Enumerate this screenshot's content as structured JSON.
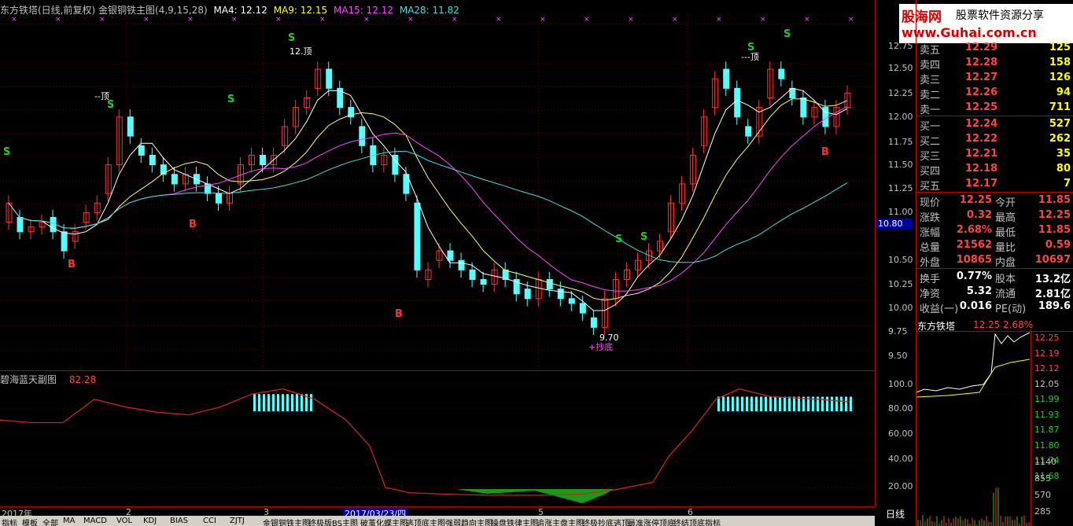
{
  "header": {
    "title": "东方铁塔(日线,前复权)",
    "indicator": "金银铜铁主图(4,9,15,28)",
    "ma": [
      {
        "label": "MA4: 12.12",
        "color": "#ffffff"
      },
      {
        "label": "MA9: 12.15",
        "color": "#ffff00"
      },
      {
        "label": "MA15: 12.12",
        "color": "#ff44ff"
      },
      {
        "label": "MA28: 11.82",
        "color": "#44dddd"
      }
    ]
  },
  "logo": {
    "line1": "股海网",
    "line2": "股票软件资源分享",
    "line3": "www.Guhai.com.cn"
  },
  "price_axis": [
    "12.75",
    "12.50",
    "12.25",
    "12.00",
    "11.75",
    "11.50",
    "11.25",
    "11.00",
    "10.80",
    "10.50",
    "10.25",
    "10.00",
    "9.75",
    "9.50"
  ],
  "price_axis_badge": "10.80",
  "annotations": {
    "top_left_peak": "--顶",
    "top_mid_peak": "12.顶",
    "top_right_peak": "---顶",
    "low_label": "9.70",
    "low_bottom": "+抄底",
    "buy": "B",
    "sell": "S"
  },
  "sub_panel": {
    "title": "碧海蓝天副图",
    "value": "82.28",
    "axis": [
      "100.0",
      "80.00",
      "60.00",
      "40.00",
      "20.00"
    ]
  },
  "bottom_axis": {
    "labels": [
      "2017年",
      "2",
      "3",
      "2017/03/23/四",
      "5",
      "6"
    ],
    "right": "日线"
  },
  "tabs": [
    "指标",
    "模板",
    "全部",
    "MA",
    "MACD",
    "VOL",
    "KDJ",
    "BIAS",
    "CCI",
    "ZJTJ",
    "金银铜铁主图",
    "终极版BS主图",
    "破茧化蝶主图",
    "逃顶底主图",
    "强弱趋向主图",
    "操盘铁律主图",
    "追涨主盘主图",
    "终极抄底逃顶",
    "最准涨停顶底",
    "终结顶底指标"
  ],
  "quote": {
    "asks": [
      {
        "label": "卖五",
        "price": "12.29",
        "vol": "125"
      },
      {
        "label": "卖四",
        "price": "12.28",
        "vol": "158"
      },
      {
        "label": "卖三",
        "price": "12.27",
        "vol": "126"
      },
      {
        "label": "卖二",
        "price": "12.26",
        "vol": "94"
      },
      {
        "label": "卖一",
        "price": "12.25",
        "vol": "711"
      }
    ],
    "bids": [
      {
        "label": "买一",
        "price": "12.24",
        "vol": "527"
      },
      {
        "label": "买二",
        "price": "12.22",
        "vol": "262"
      },
      {
        "label": "买三",
        "price": "12.21",
        "vol": "35"
      },
      {
        "label": "买四",
        "price": "12.18",
        "vol": "80"
      },
      {
        "label": "买五",
        "price": "12.17",
        "vol": "7"
      }
    ],
    "stats": [
      {
        "l1": "现价",
        "v1": "12.25",
        "l2": "今开",
        "v2": "11.85"
      },
      {
        "l1": "涨跌",
        "v1": "0.32",
        "l2": "最高",
        "v2": "12.25"
      },
      {
        "l1": "涨幅",
        "v1": "2.68%",
        "l2": "最低",
        "v2": "11.85"
      },
      {
        "l1": "总量",
        "v1": "21562",
        "l2": "量比",
        "v2": "0.59"
      },
      {
        "l1": "外盘",
        "v1": "10865",
        "l2": "内盘",
        "v2": "10697"
      }
    ],
    "stats2": [
      {
        "l1": "换手",
        "v1": "0.77%",
        "l2": "股本",
        "v2": "13.2亿"
      },
      {
        "l1": "净资",
        "v1": "5.32",
        "l2": "流通",
        "v2": "2.81亿"
      },
      {
        "l1": "收益(一)",
        "v1": "0.016",
        "l2": "PE(动)",
        "v2": "189.6"
      }
    ]
  },
  "mini": {
    "name": "东方铁塔",
    "price": "12.25",
    "pct": "2.68%",
    "axis": [
      "12.25",
      "12.19",
      "12.12",
      "12.05",
      "11.99",
      "11.93",
      "11.87",
      "11.80",
      "11.74",
      "11.68"
    ],
    "vol_axis": [
      "1140",
      "855",
      "570",
      "285"
    ]
  },
  "colors": {
    "up": "#ff3232",
    "down": "#54ffff",
    "grid": "#800000"
  }
}
